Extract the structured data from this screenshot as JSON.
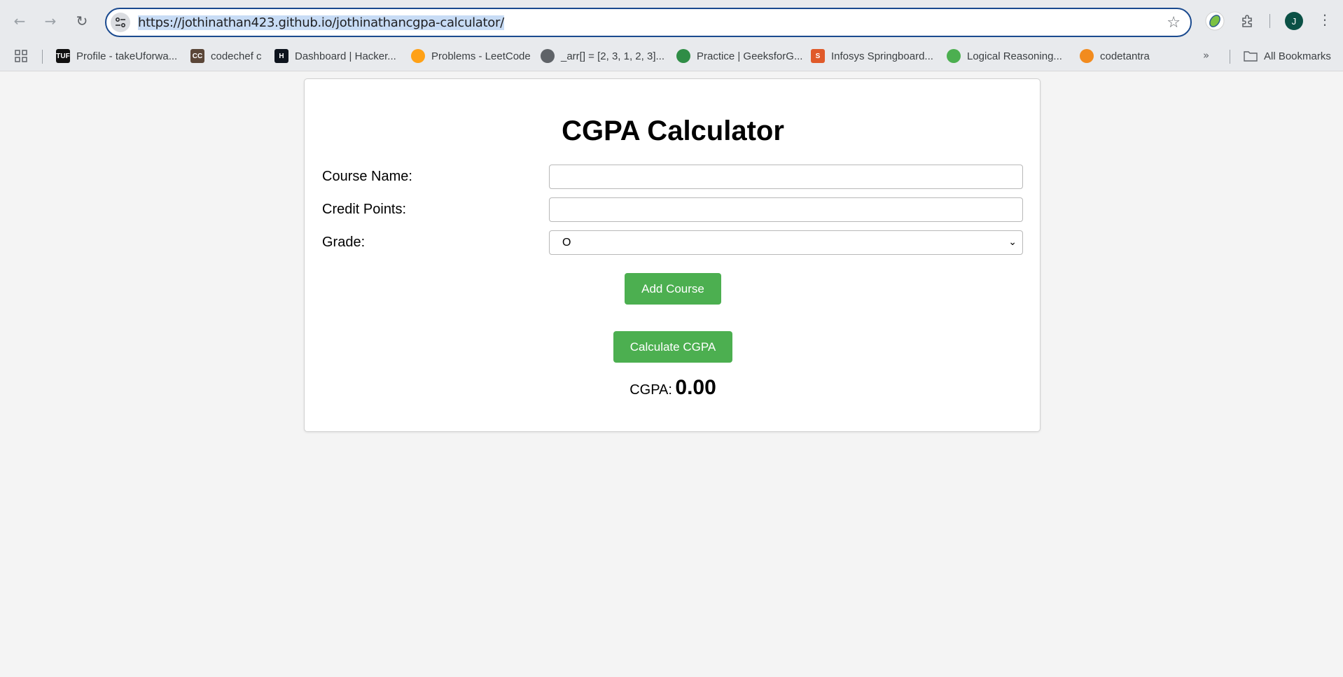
{
  "browser": {
    "url": "https://jothinathan423.github.io/jothinathancgpa-calculator/",
    "profile_initial": "J",
    "bookmarks": [
      {
        "label": "Profile - takeUforwa...",
        "icon": "tuf-icon",
        "color": "#111111",
        "icon_text": "TUF"
      },
      {
        "label": "codechef c",
        "icon": "codechef-icon",
        "color": "#5b4638",
        "icon_text": "CC"
      },
      {
        "label": "Dashboard | Hacker...",
        "icon": "hackerrank-icon",
        "color": "#0e141e",
        "icon_text": "H"
      },
      {
        "label": "Problems - LeetCode",
        "icon": "leetcode-icon",
        "color": "#ffa116",
        "icon_text": ""
      },
      {
        "label": "_arr[] = [2, 3, 1, 2, 3]...",
        "icon": "globe-icon",
        "color": "#5f6368",
        "icon_text": ""
      },
      {
        "label": "Practice | GeeksforG...",
        "icon": "gfg-icon",
        "color": "#2f8d46",
        "icon_text": ""
      },
      {
        "label": "Infosys Springboard...",
        "icon": "springboard-icon",
        "color": "#e05a2a",
        "icon_text": "S"
      },
      {
        "label": "Logical Reasoning...",
        "icon": "umbrella-icon",
        "color": "#4caf50",
        "icon_text": ""
      },
      {
        "label": "codetantra",
        "icon": "sun-icon",
        "color": "#f28b1e",
        "icon_text": ""
      }
    ],
    "all_bookmarks_label": "All Bookmarks"
  },
  "page": {
    "title": "CGPA Calculator",
    "course_name_label": "Course Name:",
    "course_name_value": "",
    "credit_points_label": "Credit Points:",
    "credit_points_value": "",
    "grade_label": "Grade:",
    "grade_selected": "O",
    "add_course_label": "Add Course",
    "calculate_label": "Calculate CGPA",
    "cgpa_label": "CGPA:",
    "cgpa_value": "0.00",
    "accent_color": "#4caf50"
  }
}
